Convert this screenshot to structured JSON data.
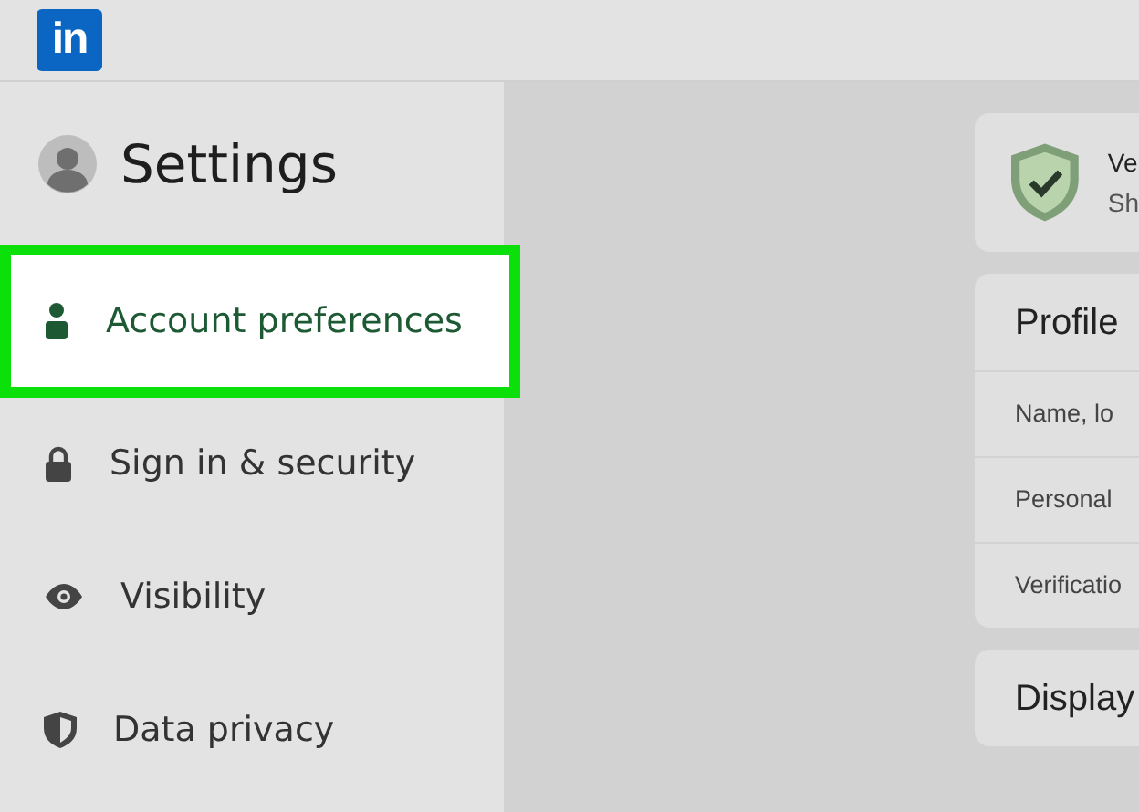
{
  "header": {
    "logo": "in"
  },
  "sidebar": {
    "title": "Settings",
    "items": [
      {
        "label": "Account preferences",
        "kind": "person",
        "selected": true
      },
      {
        "label": "Sign in & security",
        "kind": "lock",
        "selected": false
      },
      {
        "label": "Visibility",
        "kind": "eye",
        "selected": false
      },
      {
        "label": "Data privacy",
        "kind": "shield",
        "selected": false
      }
    ]
  },
  "main": {
    "verify_card": {
      "title": "Ve",
      "subtitle": "Sh"
    },
    "sections": [
      {
        "title": "Profile",
        "rows": [
          "Name, lo",
          "Personal",
          "Verificatio"
        ]
      },
      {
        "title": "Display"
      }
    ]
  }
}
